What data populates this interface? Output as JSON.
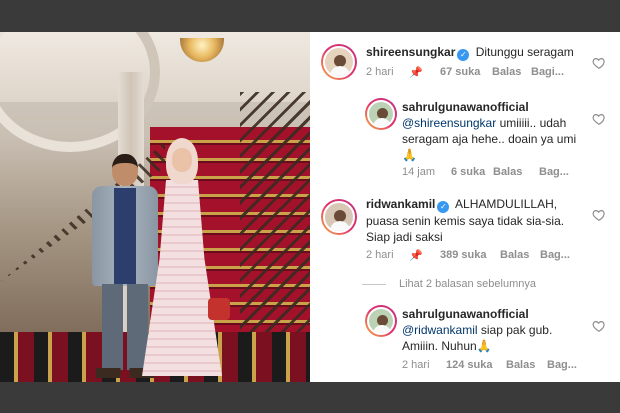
{
  "comments": [
    {
      "username": "shireensungkar",
      "verified": true,
      "text": "Ditunggu seragam",
      "time": "2 hari",
      "pinned_icon": "pin-icon",
      "likes": "67 suka",
      "reply": "Balas",
      "more": "Bagi..."
    },
    {
      "username": "sahrulgunawanofficial",
      "mention": "@shireensungkar",
      "text_line1": "umiiiii.. udah",
      "text_line2": "seragam aja hehe.. doain ya umi",
      "emoji": "🙏",
      "time": "14 jam",
      "likes": "6 suka",
      "reply": "Balas",
      "more": "Bag..."
    },
    {
      "username": "ridwankamil",
      "verified": true,
      "text_line1": "ALHAMDULILLAH,",
      "text_line2": "puasa senin kemis saya tidak sia-sia.",
      "text_line3": "Siap jadi saksi",
      "time": "2 hari",
      "pinned_icon": "pin-icon",
      "likes": "389 suka",
      "reply": "Balas",
      "more": "Bag..."
    },
    {
      "username": "sahrulgunawanofficial",
      "mention": "@ridwankamil",
      "text_line1": "siap pak gub.",
      "text_line2": "Amiiin. Nuhun",
      "emoji": "🙏",
      "time": "2 hari",
      "likes": "124 suka",
      "reply": "Balas",
      "more": "Bag..."
    }
  ],
  "view_previous_replies": "Lihat 2 balasan sebelumnya",
  "colors": {
    "link": "#00376b",
    "verified": "#3897f0",
    "muted": "#8e8e8e",
    "text": "#262626"
  }
}
